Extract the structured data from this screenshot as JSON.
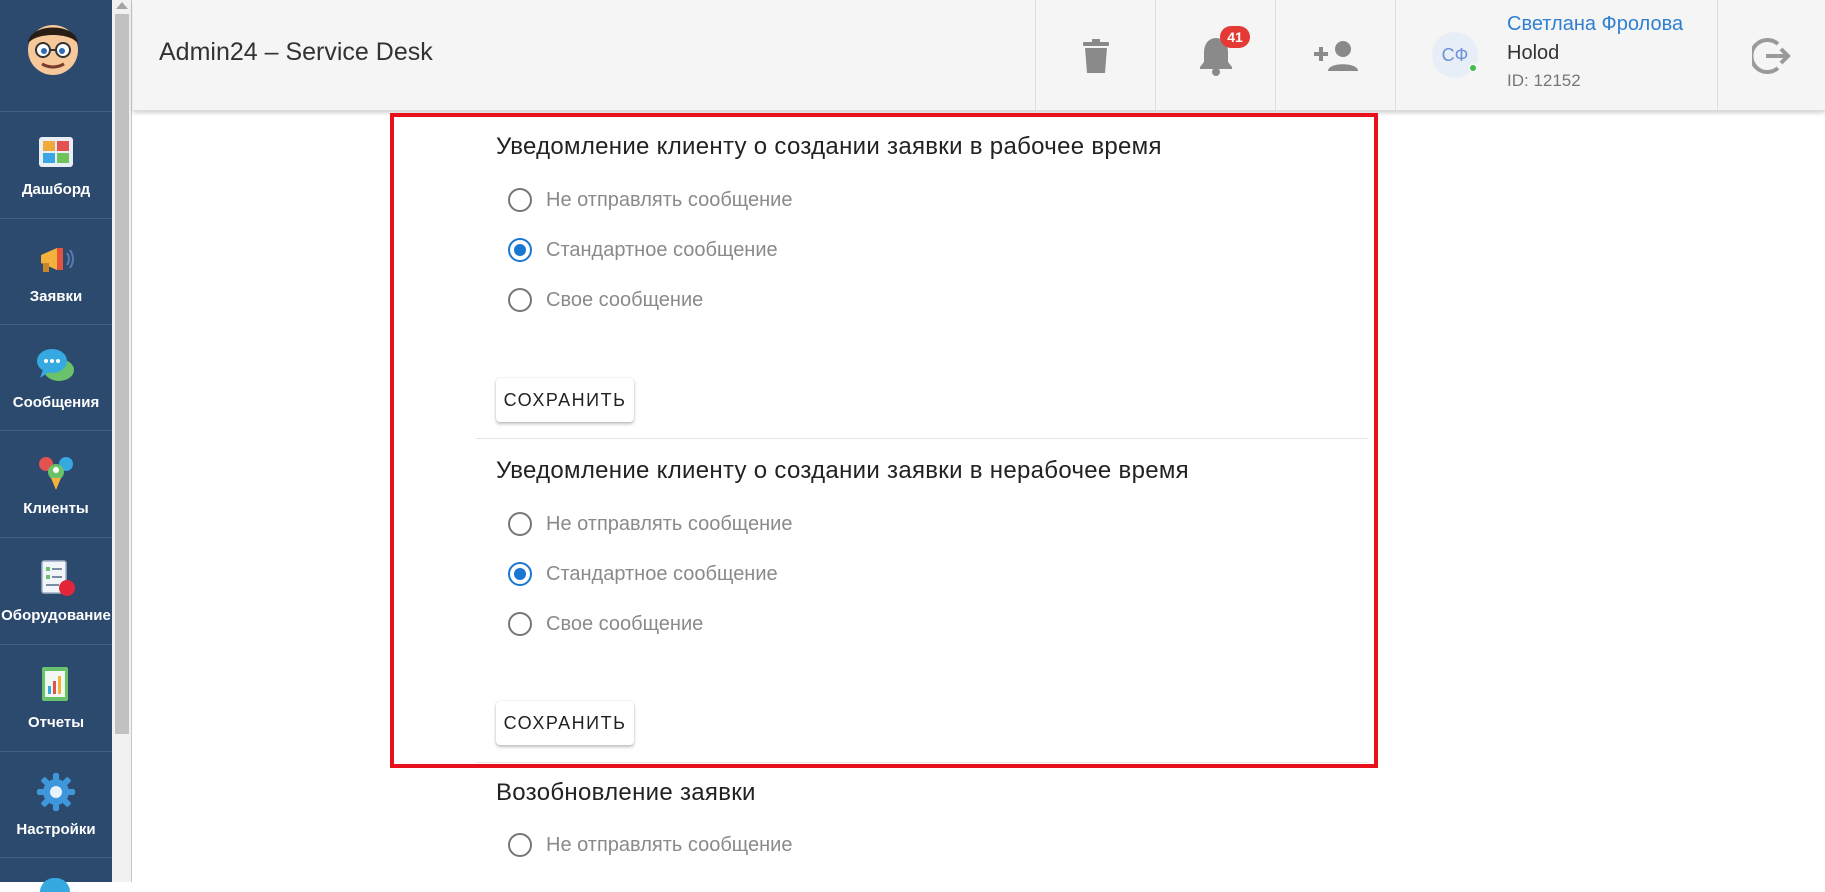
{
  "app": {
    "title": "Admin24 – Service Desk"
  },
  "sidebar": {
    "items": [
      {
        "label": "Дашборд",
        "icon": "dashboard-icon"
      },
      {
        "label": "Заявки",
        "icon": "megaphone-icon"
      },
      {
        "label": "Сообщения",
        "icon": "chat-bubbles-icon"
      },
      {
        "label": "Клиенты",
        "icon": "clients-icon"
      },
      {
        "label": "Оборудование",
        "icon": "equipment-icon"
      },
      {
        "label": "Отчеты",
        "icon": "reports-icon"
      },
      {
        "label": "Настройки",
        "icon": "gear-icon"
      }
    ]
  },
  "header": {
    "notifications_count": "41",
    "user": {
      "initials": "СФ",
      "name": "Светлана Фролова",
      "org": "Holod",
      "id": "ID: 12152"
    }
  },
  "sections": [
    {
      "title": "Уведомление клиенту о создании заявки в рабочее время",
      "options": [
        "Не отправлять сообщение",
        "Стандартное сообщение",
        "Свое сообщение"
      ],
      "selected": 1,
      "save_label": "СОХРАНИТЬ"
    },
    {
      "title": "Уведомление клиенту о создании заявки в нерабочее время",
      "options": [
        "Не отправлять сообщение",
        "Стандартное сообщение",
        "Свое сообщение"
      ],
      "selected": 1,
      "save_label": "СОХРАНИТЬ"
    },
    {
      "title": "Возобновление заявки",
      "options": [
        "Не отправлять сообщение"
      ]
    }
  ],
  "colors": {
    "sidebar": "#2c4a6e",
    "accent": "#1976d2",
    "highlight": "#e8101a",
    "badge": "#e53935",
    "user_link": "#2f7fd1"
  }
}
